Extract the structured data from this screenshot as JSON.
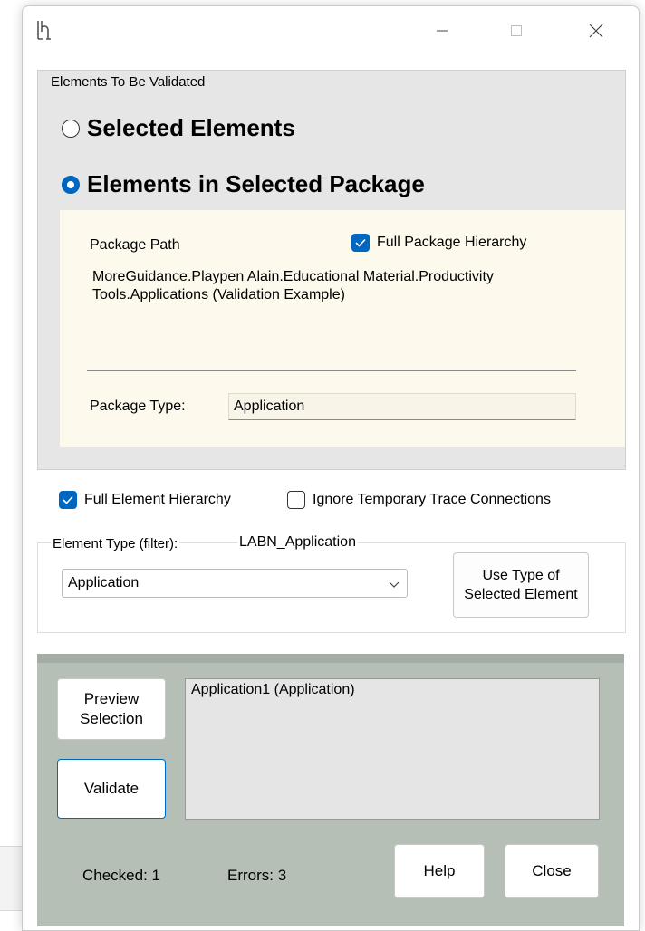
{
  "window": {
    "icon": "app-logo-icon"
  },
  "validation_scope": {
    "group_title": "Elements To Be Validated",
    "options": [
      {
        "label": "Selected Elements",
        "selected": false
      },
      {
        "label": "Elements in Selected Package",
        "selected": true
      }
    ],
    "package": {
      "path_label": "Package Path",
      "full_hierarchy_label": "Full Package Hierarchy",
      "full_hierarchy_checked": true,
      "path_value": "MoreGuidance.Playpen Alain.Educational Material.Productivity Tools.Applications (Validation Example)",
      "type_label": "Package Type:",
      "type_value": "Application"
    }
  },
  "options": {
    "full_element_hierarchy_label": "Full Element Hierarchy",
    "full_element_hierarchy_checked": true,
    "ignore_trace_label": "Ignore Temporary Trace Connections",
    "ignore_trace_checked": false
  },
  "element_type": {
    "group_title": "Element Type (filter):",
    "current_type": "LABN_Application",
    "selected_option": "Application",
    "use_type_button": "Use Type of Selected Element"
  },
  "results": {
    "preview_button": "Preview Selection",
    "validate_button": "Validate",
    "list_items": [
      "Application1 (Application)"
    ],
    "checked_text": "Checked: 1",
    "errors_text": "Errors: 3",
    "help_button": "Help",
    "close_button": "Close"
  },
  "colors": {
    "accent": "#0067c0",
    "group_bg": "#e6e6e6",
    "package_panel_bg": "#fdf9ed",
    "bottom_panel_bg": "#b5bfb5"
  }
}
